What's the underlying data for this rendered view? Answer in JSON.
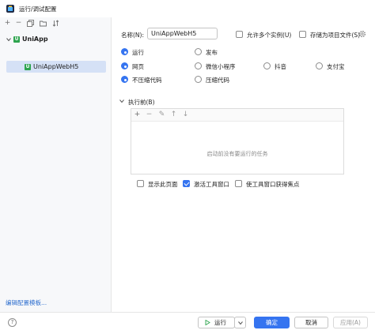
{
  "window": {
    "title": "运行/调试配置"
  },
  "left": {
    "toolbar": [
      {
        "name": "add-icon",
        "glyph": "+"
      },
      {
        "name": "remove-icon",
        "glyph": "−"
      },
      {
        "name": "copy-icon",
        "glyph": "⧉"
      },
      {
        "name": "folder-icon",
        "glyph": "▭"
      },
      {
        "name": "sort-icon",
        "glyph": "↕"
      }
    ],
    "tree": {
      "root_label": "UniApp",
      "child_label": "UniAppWebH5",
      "icon_letter": "U"
    },
    "edit_templates_link": "编辑配置模板..."
  },
  "form": {
    "name_label": "名称(N):",
    "name_value": "UniAppWebH5",
    "allow_multiple_label": "允许多个实例(U)",
    "store_as_project_label": "存储为项目文件(S)",
    "mode_options": [
      {
        "label": "运行",
        "checked": true
      },
      {
        "label": "发布",
        "checked": false
      }
    ],
    "platform_options": [
      {
        "label": "网页",
        "checked": true
      },
      {
        "label": "微信小程序",
        "checked": false
      },
      {
        "label": "抖音",
        "checked": false
      },
      {
        "label": "支付宝",
        "checked": false
      }
    ],
    "compress_options": [
      {
        "label": "不压缩代码",
        "checked": true
      },
      {
        "label": "压缩代码",
        "checked": false
      }
    ],
    "before_launch_label": "执行前(B)",
    "before_launch_empty": "启动前没有要运行的任务",
    "panel_toolbar": [
      {
        "name": "add-task-icon",
        "glyph": "+"
      },
      {
        "name": "remove-task-icon",
        "glyph": "−"
      },
      {
        "name": "edit-task-icon",
        "glyph": "✎"
      },
      {
        "name": "move-up-icon",
        "glyph": "↑"
      },
      {
        "name": "move-down-icon",
        "glyph": "↓"
      }
    ],
    "options": [
      {
        "label": "显示此页面",
        "checked": false
      },
      {
        "label": "激活工具窗口",
        "checked": true
      },
      {
        "label": "使工具窗口获得焦点",
        "checked": false
      }
    ]
  },
  "footer": {
    "help": "?",
    "run_label": "运行",
    "ok_label": "确定",
    "cancel_label": "取消",
    "apply_label": "应用(A)"
  },
  "colors": {
    "accent": "#3574f0",
    "link": "#2f6fcf",
    "uniapp_green": "#2ea44f",
    "selection": "#d5e1f6"
  }
}
